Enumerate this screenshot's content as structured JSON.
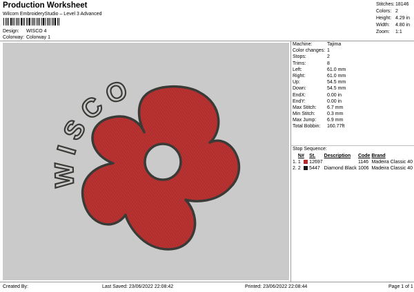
{
  "header": {
    "title": "Production Worksheet",
    "subtitle": "Wilcom EmbroideryStudio – Level 3 Advanced",
    "design_label": "Design:",
    "design_value": "WISCO 4",
    "colorway_label": "Colorway:",
    "colorway_value": "Colorway 1"
  },
  "stats": [
    {
      "label": "Stitches:",
      "value": "18146"
    },
    {
      "label": "Colors:",
      "value": "2"
    },
    {
      "label": "Height:",
      "value": "4.29 in"
    },
    {
      "label": "Width:",
      "value": "4.80 in"
    },
    {
      "label": "Zoom:",
      "value": "1:1"
    }
  ],
  "artwork": {
    "text": "WISCO",
    "fill_color": "#b83232",
    "outline_color": "#3a3a36",
    "background_color": "#cacaca"
  },
  "machine_info": [
    {
      "label": "Machine:",
      "value": "Tajima"
    },
    {
      "label": "Color changes:",
      "value": "1"
    },
    {
      "label": "Stops:",
      "value": "2"
    },
    {
      "label": "Trims:",
      "value": "8"
    },
    {
      "label": "Left:",
      "value": "61.0 mm"
    },
    {
      "label": "Right:",
      "value": "61.0 mm"
    },
    {
      "label": "Up:",
      "value": "54.5 mm"
    },
    {
      "label": "Down:",
      "value": "54.5 mm"
    },
    {
      "label": "EndX:",
      "value": "0.00 in"
    },
    {
      "label": "EndY:",
      "value": "0.00 in"
    },
    {
      "label": "Max Stitch:",
      "value": "6.7 mm"
    },
    {
      "label": "Min Stitch:",
      "value": "0.3 mm"
    },
    {
      "label": "Max Jump:",
      "value": "6.9 mm"
    },
    {
      "label": "Total Bobbin:",
      "value": "160.77ft"
    }
  ],
  "stop_sequence": {
    "title": "Stop Sequence:",
    "headers": {
      "n": "N#",
      "st": "St.",
      "description": "Description",
      "code": "Code",
      "brand": "Brand"
    },
    "rows": [
      {
        "index": "1.",
        "n": "1",
        "color": "#b32b2b",
        "st": "12697",
        "description": "",
        "code": "1146",
        "brand": "Madeira Classic 40"
      },
      {
        "index": "2.",
        "n": "2",
        "color": "#1a1a1a",
        "st": "5447",
        "description": "Diamond Black",
        "code": "1006",
        "brand": "Madeira Classic 40"
      }
    ]
  },
  "footer": {
    "created_by": "Created By:",
    "last_saved": "Last Saved: 23/06/2022 22:08:42",
    "printed": "Printed: 23/06/2022 22:08:44",
    "page": "Page 1 of 1"
  }
}
